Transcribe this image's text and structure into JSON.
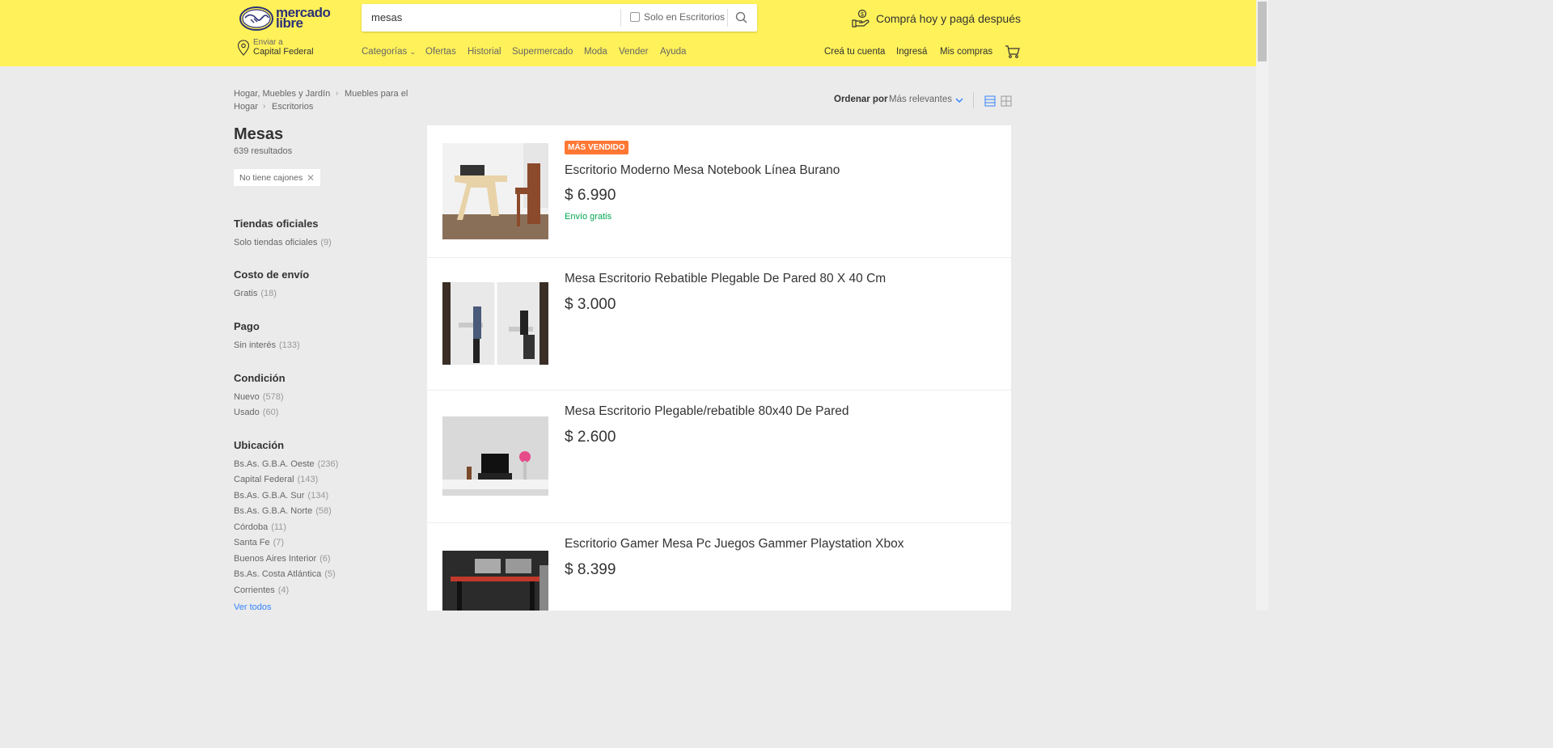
{
  "header": {
    "logo_line1": "mercado",
    "logo_line2": "libre",
    "search_value": "mesas",
    "search_checkbox_label": "Solo en Escritorios",
    "promo": "Comprá hoy y pagá después",
    "ship_label": "Enviar a",
    "ship_city": "Capital Federal",
    "nav": [
      "Categorías",
      "Ofertas",
      "Historial",
      "Supermercado",
      "Moda",
      "Vender",
      "Ayuda"
    ],
    "account": [
      "Creá tu cuenta",
      "Ingresá",
      "Mis compras"
    ],
    "accent_color": "#fff159"
  },
  "breadcrumb": {
    "items": [
      "Hogar, Muebles y Jardín",
      "Muebles para el",
      "Hogar",
      "Escritorios"
    ]
  },
  "page": {
    "title": "Mesas",
    "results": "639 resultados",
    "active_filter": "No tiene cajones"
  },
  "filters": [
    {
      "title": "Tiendas oficiales",
      "items": [
        {
          "label": "Solo tiendas oficiales",
          "count": "(9)"
        }
      ]
    },
    {
      "title": "Costo de envío",
      "items": [
        {
          "label": "Gratis",
          "count": "(18)"
        }
      ]
    },
    {
      "title": "Pago",
      "items": [
        {
          "label": "Sin interés",
          "count": "(133)"
        }
      ]
    },
    {
      "title": "Condición",
      "items": [
        {
          "label": "Nuevo",
          "count": "(578)"
        },
        {
          "label": "Usado",
          "count": "(60)"
        }
      ]
    },
    {
      "title": "Ubicación",
      "items": [
        {
          "label": "Bs.As. G.B.A. Oeste",
          "count": "(236)"
        },
        {
          "label": "Capital Federal",
          "count": "(143)"
        },
        {
          "label": "Bs.As. G.B.A. Sur",
          "count": "(134)"
        },
        {
          "label": "Bs.As. G.B.A. Norte",
          "count": "(58)"
        },
        {
          "label": "Córdoba",
          "count": "(11)"
        },
        {
          "label": "Santa Fe",
          "count": "(7)"
        },
        {
          "label": "Buenos Aires Interior",
          "count": "(6)"
        },
        {
          "label": "Bs.As. Costa Atlántica",
          "count": "(5)"
        },
        {
          "label": "Corrientes",
          "count": "(4)"
        }
      ]
    }
  ],
  "see_all": "Ver todos",
  "sort": {
    "label": "Ordenar por",
    "value": "Más relevantes"
  },
  "items": [
    {
      "badge": "MÁS VENDIDO",
      "title": "Escritorio Moderno Mesa Notebook Línea Burano",
      "price": "$ 6.990",
      "shipping": "Envío gratis"
    },
    {
      "badge": "",
      "title": "Mesa Escritorio Rebatible Plegable De Pared 80 X 40 Cm",
      "price": "$ 3.000",
      "shipping": ""
    },
    {
      "badge": "",
      "title": "Mesa Escritorio Plegable/rebatible 80x40 De Pared",
      "price": "$ 2.600",
      "shipping": ""
    },
    {
      "badge": "",
      "title": "Escritorio Gamer Mesa Pc Juegos Gammer Playstation Xbox",
      "price": "$ 8.399",
      "shipping": ""
    }
  ]
}
